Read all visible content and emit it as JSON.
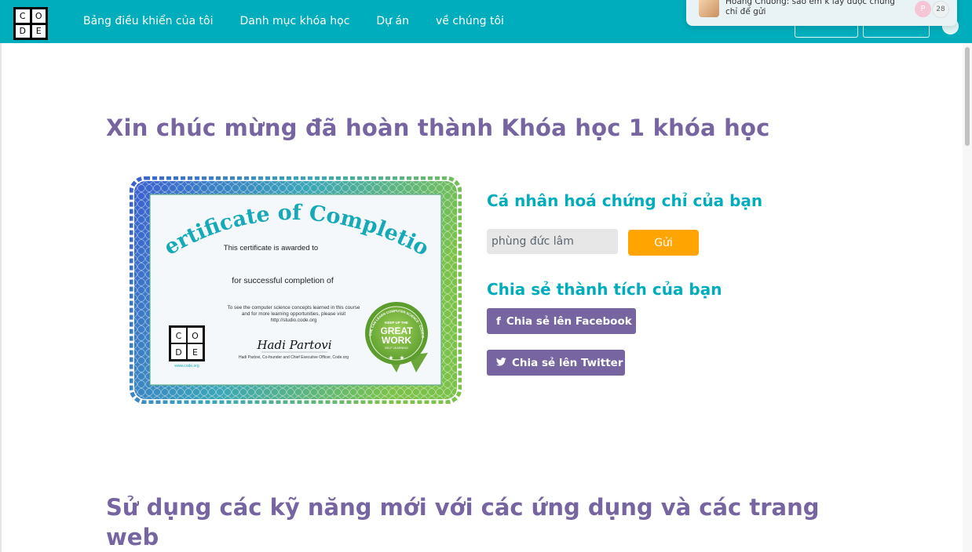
{
  "logo": {
    "letters": [
      "C",
      "O",
      "D",
      "E"
    ]
  },
  "nav": {
    "items": [
      "Bảng điều khiển của tôi",
      "Danh mục khóa học",
      "Dự án",
      "về chúng tôi"
    ]
  },
  "notification": {
    "text": "Hoàng Chương: sao em k lấy được chứng chỉ để gửi",
    "avatar_letter": "P",
    "count": "28"
  },
  "main": {
    "title": "Xin chúc mừng đã hoàn thành Khóa học 1 khóa học",
    "certificate": {
      "heading": "Certificate of Completion",
      "awarded": "This certificate is awarded to",
      "completion": "for successful completion of",
      "info_line1": "To see the computer science concepts learned in this course",
      "info_line2": "and for more learning opportunities, please visit",
      "info_line3": "http://studio.code.org",
      "signature": "Hadi Partovi",
      "signer": "Hadi Partovi, Co-founder and Chief Executive Officer, Code.org",
      "seal_top": "KEEP UP THE",
      "seal_main1": "GREAT",
      "seal_main2": "WORK",
      "seal_bottom": "SELF LEARNING",
      "seal_ring": "ANYONE CAN LEARN COMPUTER SCIENCE · CODE.ORG",
      "logo_url": "www.code.org"
    },
    "personalize": {
      "heading": "Cá nhân hoá chứng chỉ của bạn",
      "name_value": "phùng đức lâm",
      "send_label": "Gửi"
    },
    "share": {
      "heading": "Chia sẻ thành tích của bạn",
      "facebook_icon": "f",
      "facebook_label": "Chia sẻ lên Facebook",
      "twitter_label": "Chia sẻ lên Twitter"
    },
    "apps_title": "Sử dụng các kỹ năng mới với các ứng dụng và các trang web"
  },
  "colors": {
    "header": "#00adbc",
    "title": "#7665a0",
    "accent": "#00adbc",
    "button": "#ffa400",
    "share": "#7665a0"
  }
}
